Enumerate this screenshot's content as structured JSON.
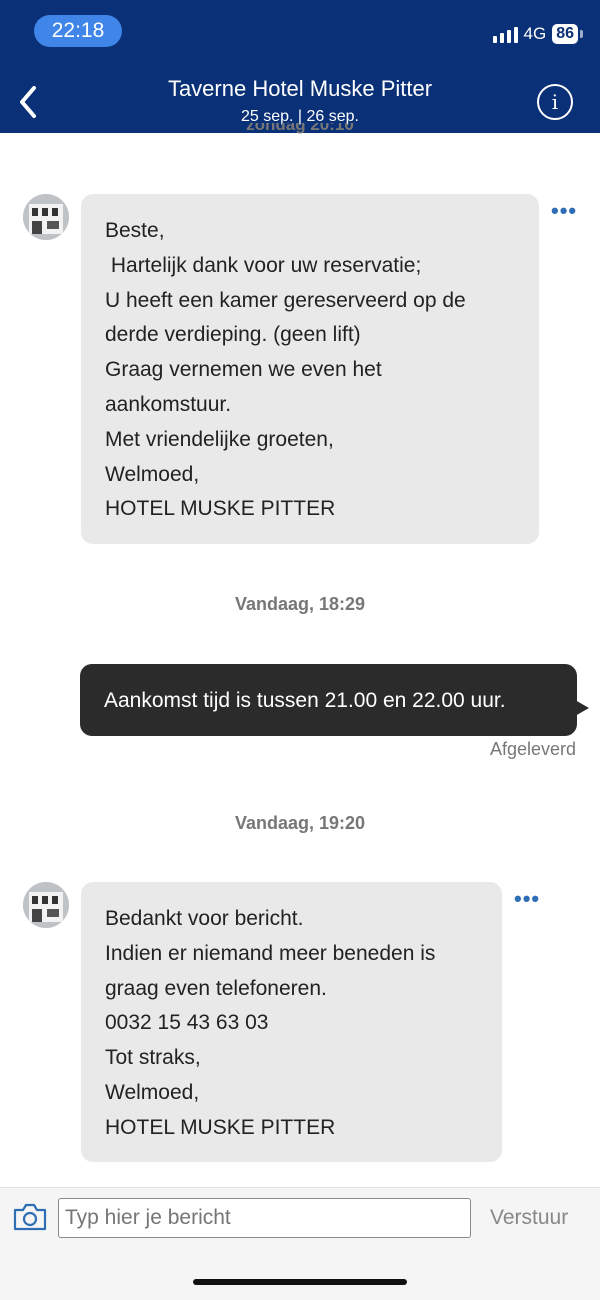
{
  "status_bar": {
    "time": "22:18",
    "network": "4G",
    "battery": "86"
  },
  "header": {
    "title": "Taverne Hotel Muske Pitter",
    "subtitle": "25 sep. | 26 sep."
  },
  "messages": {
    "cut_timestamp": "zondag 20:10",
    "first": {
      "text": "Beste,\n Hartelijk dank voor uw reservatie;\nU heeft een kamer gereserveerd op de\nderde verdieping. (geen lift)\nGraag vernemen we even het\naankomstuur.\nMet vriendelijke groeten,\nWelmoed,\nHOTEL MUSKE PITTER"
    },
    "timestamp2": "Vandaag, 18:29",
    "outgoing": {
      "text": "Aankomst tijd is tussen 21.00 en 22.00 uur.",
      "status": "Afgeleverd"
    },
    "timestamp3": "Vandaag, 19:20",
    "second": {
      "text": "Bedankt voor bericht.\nIndien er niemand meer beneden is\ngraag even telefoneren.\n0032 15 43 63 03\nTot straks,\nWelmoed,\nHOTEL MUSKE PITTER"
    },
    "more_glyph": "•••"
  },
  "composer": {
    "placeholder": "Typ hier je bericht",
    "send_label": "Verstuur"
  },
  "colors": {
    "header_bg": "#0a3177",
    "time_pill": "#3f86e8",
    "incoming_bubble": "#e9e9e9",
    "outgoing_bubble": "#2b2b2b",
    "accent": "#2f6db5"
  }
}
